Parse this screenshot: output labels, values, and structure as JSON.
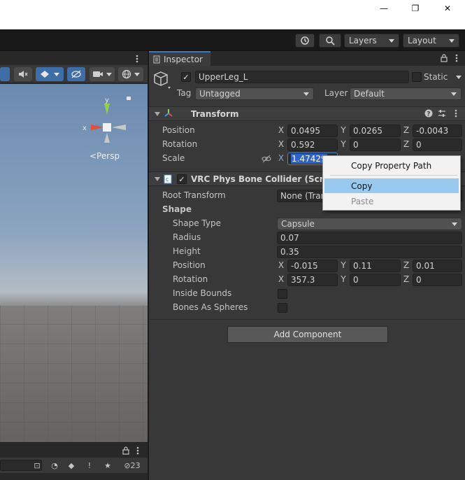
{
  "window": {
    "minimize_glyph": "—",
    "maximize_glyph": "❐",
    "close_glyph": "✕"
  },
  "toolbar": {
    "layers_label": "Layers",
    "layout_label": "Layout"
  },
  "scene": {
    "persp_label": "Persp",
    "gizmo_x": "x",
    "gizmo_y": "y",
    "hidden_count": "23"
  },
  "inspector": {
    "tab_label": "Inspector",
    "object": {
      "name": "UpperLeg_L",
      "active": true,
      "static_label": "Static",
      "tag_label": "Tag",
      "tag_value": "Untagged",
      "layer_label": "Layer",
      "layer_value": "Default"
    },
    "transform": {
      "title": "Transform",
      "position": {
        "label": "Position",
        "x": "0.0495",
        "y": "0.0265",
        "z": "-0.0043"
      },
      "rotation": {
        "label": "Rotation",
        "x": "0.592",
        "y": "0",
        "z": "0"
      },
      "scale": {
        "label": "Scale",
        "x": "1.47429"
      }
    },
    "phys_bone_collider": {
      "title": "VRC Phys Bone Collider (Script)",
      "enabled": true,
      "root_transform_label": "Root Transform",
      "root_transform_value": "None (Trans",
      "shape_header": "Shape",
      "shape_type_label": "Shape Type",
      "shape_type_value": "Capsule",
      "radius_label": "Radius",
      "radius_value": "0.07",
      "height_label": "Height",
      "height_value": "0.35",
      "position": {
        "label": "Position",
        "x": "-0.015",
        "y": "0.11",
        "z": "0.01"
      },
      "rotation": {
        "label": "Rotation",
        "x": "357.3",
        "y": "0",
        "z": "0"
      },
      "inside_bounds_label": "Inside Bounds",
      "bones_as_spheres_label": "Bones As Spheres"
    },
    "add_component_label": "Add Component"
  },
  "axes": {
    "x": "X",
    "y": "Y",
    "z": "Z"
  },
  "context_menu": {
    "items": [
      {
        "label": "Copy Property Path",
        "state": "normal"
      },
      {
        "label": "Copy",
        "state": "selected"
      },
      {
        "label": "Paste",
        "state": "disabled"
      }
    ]
  }
}
